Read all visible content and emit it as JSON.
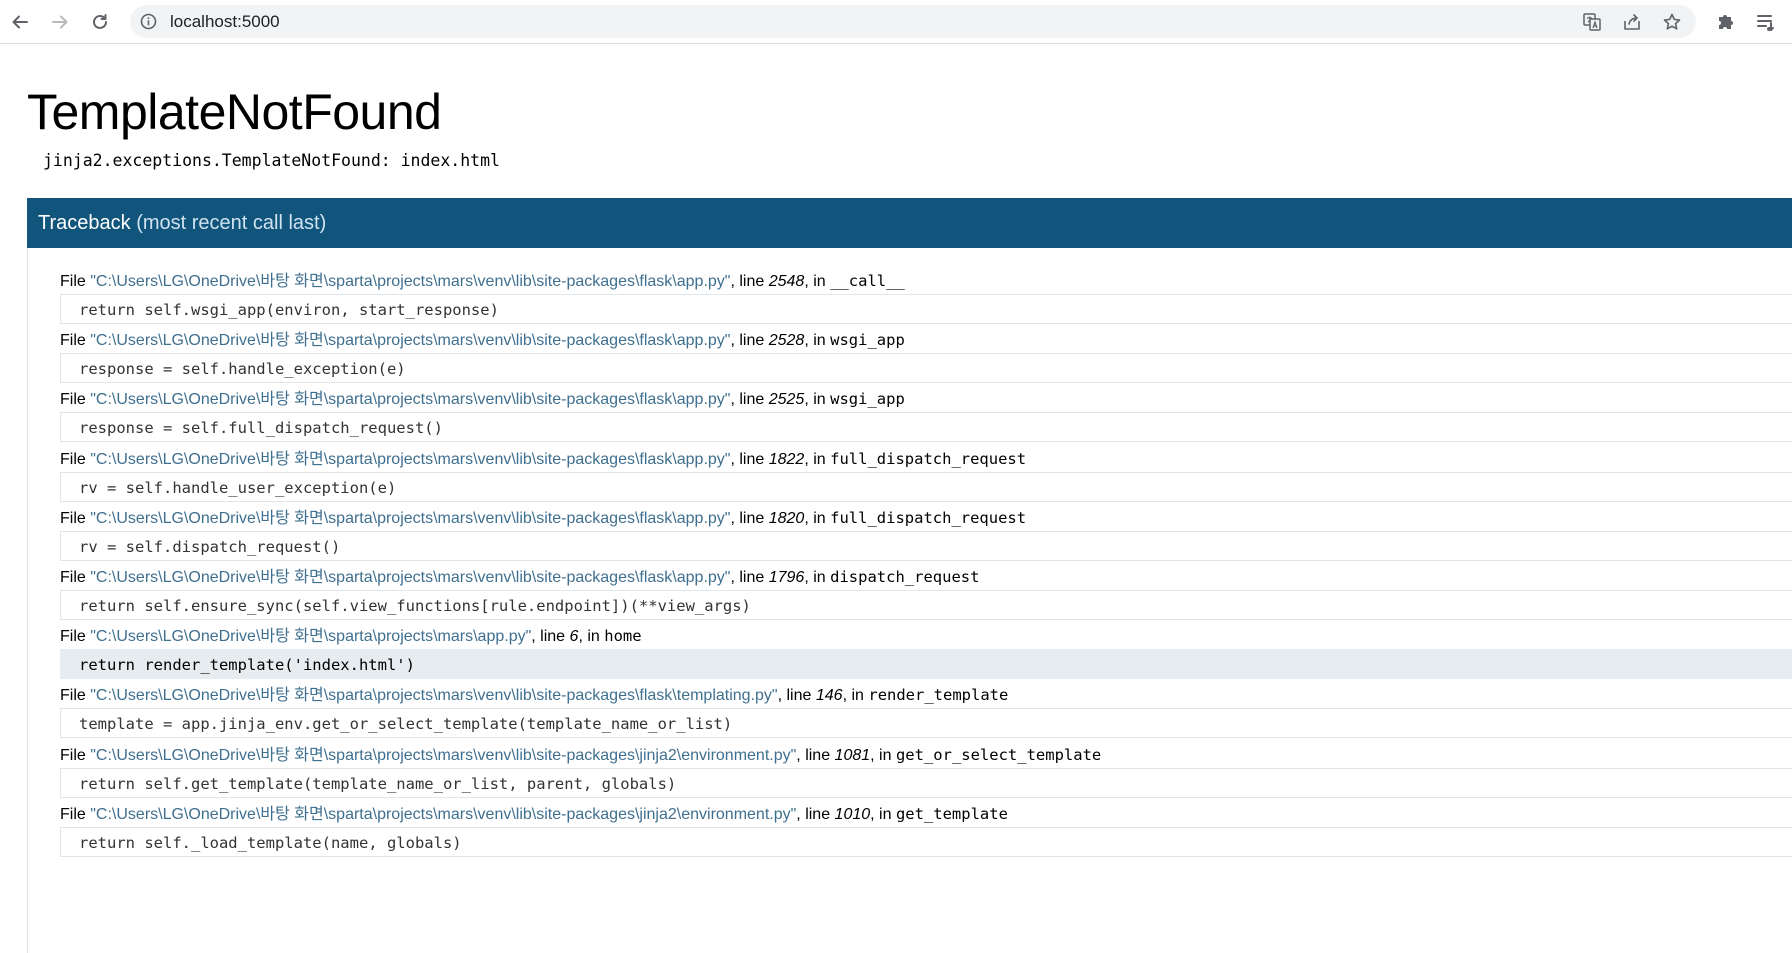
{
  "browser": {
    "url": "localhost:5000"
  },
  "error": {
    "title": "TemplateNotFound",
    "message": "jinja2.exceptions.TemplateNotFound: index.html"
  },
  "traceback": {
    "header_main": "Traceback",
    "header_sub": "(most recent call last)",
    "frames": [
      {
        "file_prefix": "File ",
        "filename": "\"C:\\Users\\LG\\OneDrive\\바탕 화면\\sparta\\projects\\mars\\venv\\lib\\site-packages\\flask\\app.py\"",
        "line_label": ", line ",
        "lineno": "2548",
        "in_label": ", in ",
        "func": "__call__",
        "code": "return self.wsgi_app(environ, start_response)",
        "current": false
      },
      {
        "file_prefix": "File ",
        "filename": "\"C:\\Users\\LG\\OneDrive\\바탕 화면\\sparta\\projects\\mars\\venv\\lib\\site-packages\\flask\\app.py\"",
        "line_label": ", line ",
        "lineno": "2528",
        "in_label": ", in ",
        "func": "wsgi_app",
        "code": "response = self.handle_exception(e)",
        "current": false
      },
      {
        "file_prefix": "File ",
        "filename": "\"C:\\Users\\LG\\OneDrive\\바탕 화면\\sparta\\projects\\mars\\venv\\lib\\site-packages\\flask\\app.py\"",
        "line_label": ", line ",
        "lineno": "2525",
        "in_label": ", in ",
        "func": "wsgi_app",
        "code": "response = self.full_dispatch_request()",
        "current": false
      },
      {
        "file_prefix": "File ",
        "filename": "\"C:\\Users\\LG\\OneDrive\\바탕 화면\\sparta\\projects\\mars\\venv\\lib\\site-packages\\flask\\app.py\"",
        "line_label": ", line ",
        "lineno": "1822",
        "in_label": ", in ",
        "func": "full_dispatch_request",
        "code": "rv = self.handle_user_exception(e)",
        "current": false
      },
      {
        "file_prefix": "File ",
        "filename": "\"C:\\Users\\LG\\OneDrive\\바탕 화면\\sparta\\projects\\mars\\venv\\lib\\site-packages\\flask\\app.py\"",
        "line_label": ", line ",
        "lineno": "1820",
        "in_label": ", in ",
        "func": "full_dispatch_request",
        "code": "rv = self.dispatch_request()",
        "current": false
      },
      {
        "file_prefix": "File ",
        "filename": "\"C:\\Users\\LG\\OneDrive\\바탕 화면\\sparta\\projects\\mars\\venv\\lib\\site-packages\\flask\\app.py\"",
        "line_label": ", line ",
        "lineno": "1796",
        "in_label": ", in ",
        "func": "dispatch_request",
        "code": "return self.ensure_sync(self.view_functions[rule.endpoint])(**view_args)",
        "current": false
      },
      {
        "file_prefix": "File ",
        "filename": "\"C:\\Users\\LG\\OneDrive\\바탕 화면\\sparta\\projects\\mars\\app.py\"",
        "line_label": ", line ",
        "lineno": "6",
        "in_label": ", in ",
        "func": "home",
        "code": "return render_template('index.html')",
        "current": true
      },
      {
        "file_prefix": "File ",
        "filename": "\"C:\\Users\\LG\\OneDrive\\바탕 화면\\sparta\\projects\\mars\\venv\\lib\\site-packages\\flask\\templating.py\"",
        "line_label": ", line ",
        "lineno": "146",
        "in_label": ", in ",
        "func": "render_template",
        "code": "template = app.jinja_env.get_or_select_template(template_name_or_list)",
        "current": false
      },
      {
        "file_prefix": "File ",
        "filename": "\"C:\\Users\\LG\\OneDrive\\바탕 화면\\sparta\\projects\\mars\\venv\\lib\\site-packages\\jinja2\\environment.py\"",
        "line_label": ", line ",
        "lineno": "1081",
        "in_label": ", in ",
        "func": "get_or_select_template",
        "code": "return self.get_template(template_name_or_list, parent, globals)",
        "current": false
      },
      {
        "file_prefix": "File ",
        "filename": "\"C:\\Users\\LG\\OneDrive\\바탕 화면\\sparta\\projects\\mars\\venv\\lib\\site-packages\\jinja2\\environment.py\"",
        "line_label": ", line ",
        "lineno": "1010",
        "in_label": ", in ",
        "func": "get_template",
        "code": "return self._load_template(name, globals)",
        "current": false
      }
    ]
  },
  "icons": {
    "back": "arrow-back-icon",
    "forward": "arrow-forward-icon",
    "reload": "reload-icon",
    "site_info": "info-icon",
    "translate": "translate-icon",
    "share": "share-icon",
    "bookmark": "star-icon",
    "extensions": "puzzle-icon",
    "reading_list": "reading-list-icon"
  },
  "colors": {
    "traceback_header": "#11557c",
    "filename_link": "#3f6f8f",
    "current_line_bg": "#e6ecef"
  }
}
